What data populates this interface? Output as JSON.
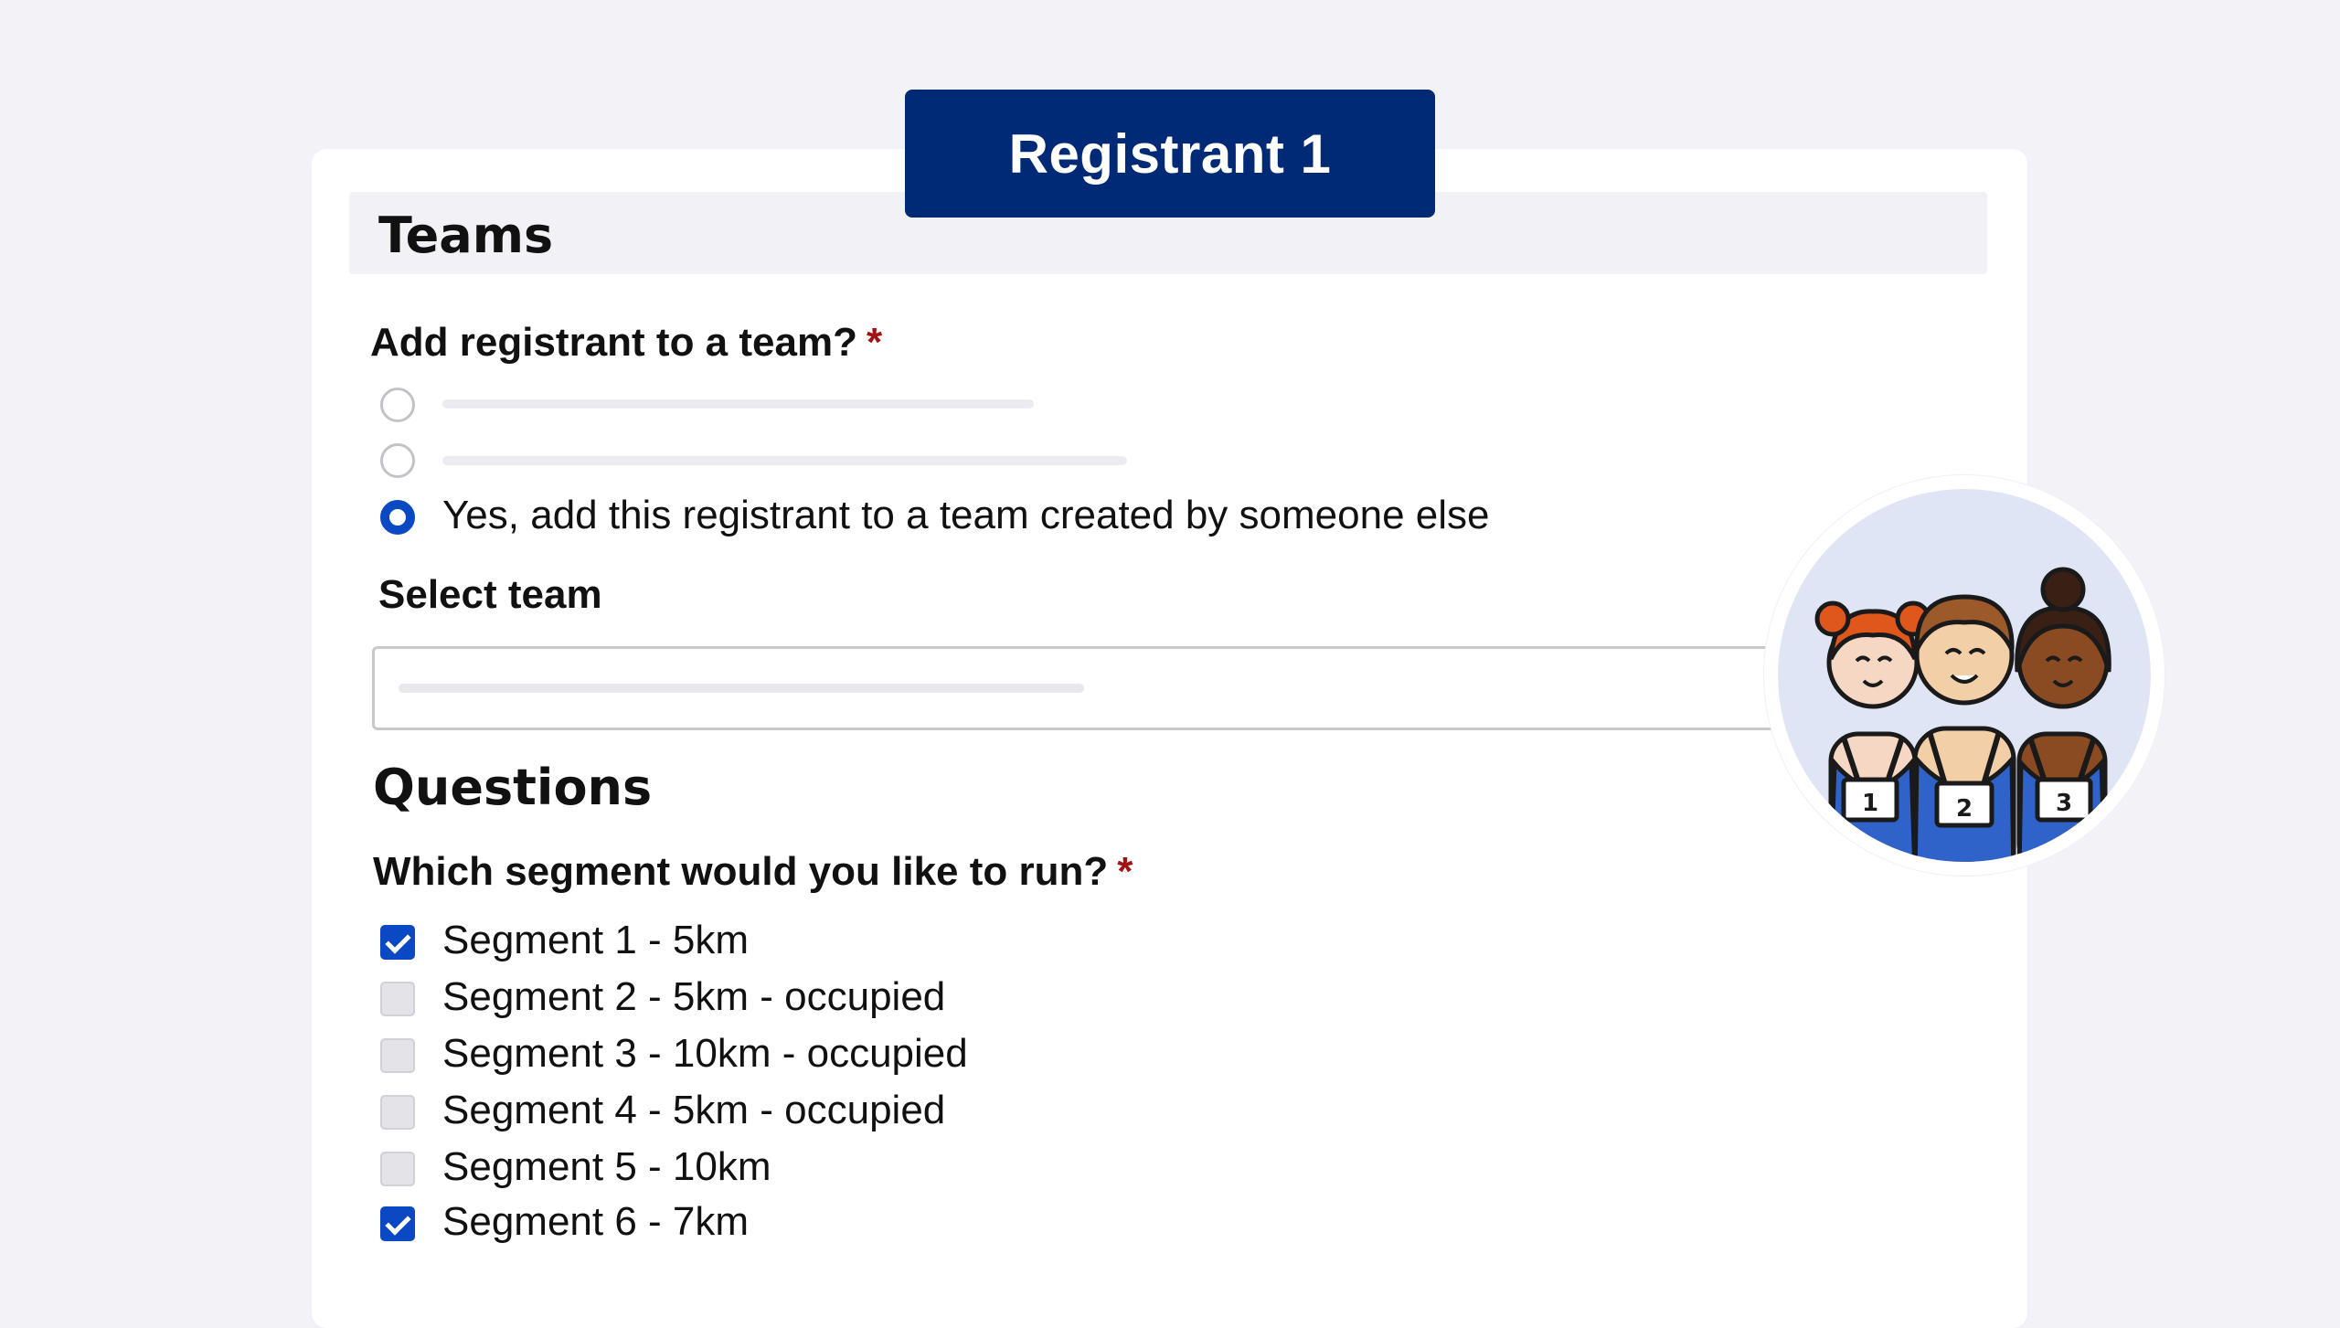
{
  "banner": {
    "title": "Registrant 1"
  },
  "teams": {
    "heading": "Teams",
    "question": "Add registrant to a team?",
    "required_mark": "*",
    "selected_option": "Yes, add this registrant to a team created by someone else",
    "select_team_label": "Select team"
  },
  "questions": {
    "heading": "Questions",
    "segment_question": "Which segment would you like to run?",
    "required_mark": "*",
    "segments": [
      {
        "label": "Segment 1 - 5km",
        "checked": true
      },
      {
        "label": "Segment 2 - 5km - occupied",
        "checked": false
      },
      {
        "label": "Segment 3 - 10km - occupied",
        "checked": false
      },
      {
        "label": "Segment 4 - 5km - occupied",
        "checked": false
      },
      {
        "label": "Segment 5 - 10km",
        "checked": false
      },
      {
        "label": "Segment 6 - 7km",
        "checked": true
      }
    ]
  },
  "illustration": {
    "bib_numbers": [
      "1",
      "2",
      "3"
    ]
  },
  "colors": {
    "brand_navy": "#002a75",
    "accent_blue": "#0b49c4",
    "required_red": "#a31212"
  }
}
